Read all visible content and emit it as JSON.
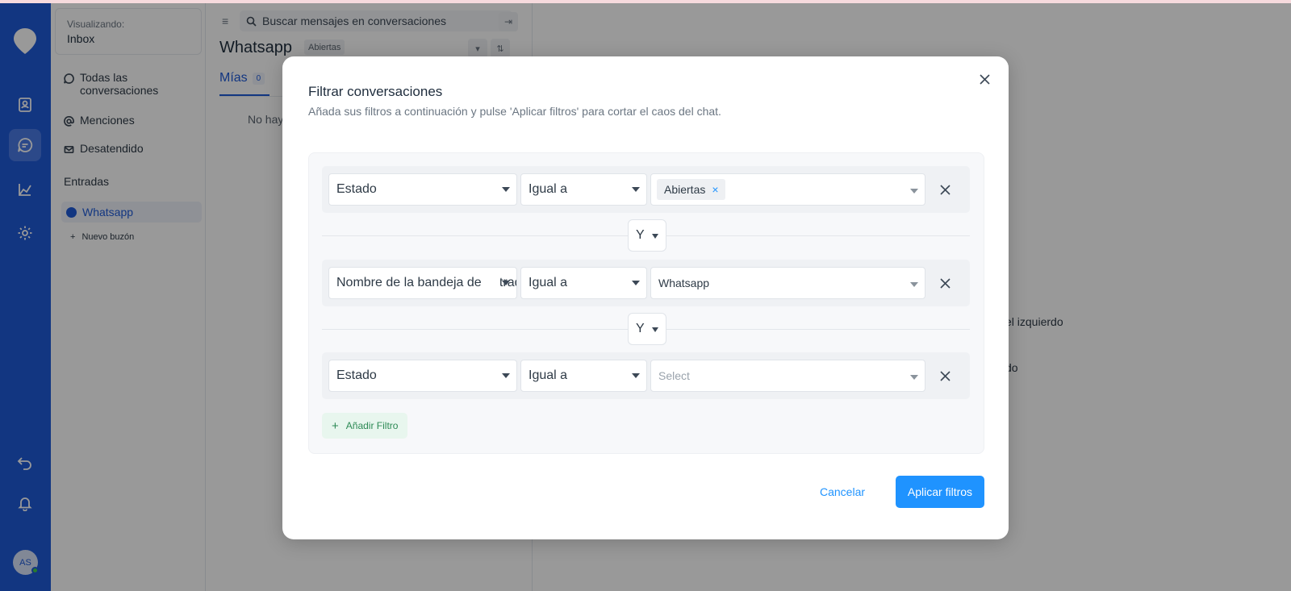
{
  "sidebar": {
    "viewing_label": "Visualizando:",
    "viewing_value": "Inbox",
    "nav": [
      {
        "label": "Todas las conversaciones",
        "icon": "chat-bubble-icon"
      },
      {
        "label": "Menciones",
        "icon": "at-icon"
      },
      {
        "label": "Desatendido",
        "icon": "mail-icon"
      }
    ],
    "section_title": "Entradas",
    "inbox": "Whatsapp",
    "new_inbox": "Nuevo buzón"
  },
  "conversations": {
    "search_placeholder": "Buscar mensajes en conversaciones",
    "title": "Whatsapp",
    "status_badge": "Abiertas",
    "tab_mine": "Mías",
    "tab_mine_count": "0",
    "empty_text": "No hay"
  },
  "right_pane": {
    "text_1": "el izquierdo",
    "text_2": "do"
  },
  "user": {
    "initials": "AS"
  },
  "modal": {
    "title": "Filtrar conversaciones",
    "subtitle": "Añada sus filtros a continuación y pulse 'Aplicar filtros' para cortar el caos del chat.",
    "filters": [
      {
        "attribute": "Estado",
        "operator": "Igual a",
        "value_chip": "Abiertas"
      },
      {
        "attribute": "Nombre de la bandeja de entrada",
        "operator": "Igual a",
        "value": "Whatsapp"
      },
      {
        "attribute": "Estado",
        "operator": "Igual a",
        "placeholder": "Select"
      }
    ],
    "joins": [
      "Y",
      "Y"
    ],
    "add_filter": "Añadir Filtro",
    "cancel": "Cancelar",
    "apply": "Aplicar filtros"
  },
  "colors": {
    "rail": "#1f5ad8",
    "primary": "#1f93ff",
    "success_bg": "#e8f6ee"
  }
}
